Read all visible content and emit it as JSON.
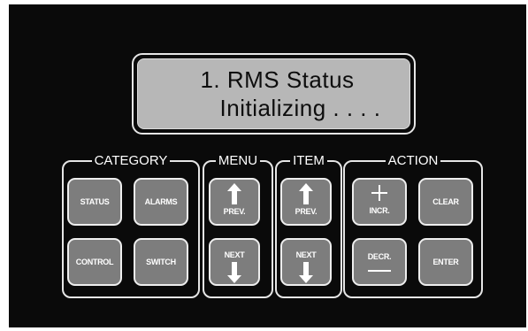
{
  "display": {
    "line1": "1. RMS Status",
    "line2": "Initializing . . . ."
  },
  "groups": {
    "category": "CATEGORY",
    "menu": "MENU",
    "item": "ITEM",
    "action": "ACTION"
  },
  "keys": {
    "status": "STATUS",
    "alarms": "ALARMS",
    "control": "CONTROL",
    "switch": "SWITCH",
    "menu_prev": "PREV.",
    "menu_next": "NEXT",
    "item_prev": "PREV.",
    "item_next": "NEXT",
    "incr": "INCR.",
    "clear": "CLEAR",
    "decr": "DECR.",
    "enter": "ENTER"
  },
  "icons": {
    "up_arrow": "arrow-up-icon",
    "down_arrow": "arrow-down-icon",
    "plus": "plus-icon",
    "minus": "minus-icon"
  },
  "colors": {
    "panel": "#0a0a0a",
    "lcd": "#b7b7b7",
    "key": "#7d7d7d",
    "outline": "#e6e6e6"
  }
}
